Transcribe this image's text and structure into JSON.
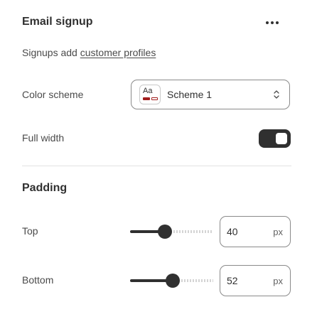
{
  "section": {
    "title": "Email signup",
    "more_icon": "more-horizontal-icon"
  },
  "signups": {
    "prefix": "Signups add ",
    "link_text": "customer profiles"
  },
  "color_scheme": {
    "label": "Color scheme",
    "swatch_text": "Aa",
    "value": "Scheme 1",
    "swatch_colors": {
      "primary": "#a11d1d",
      "background": "#ffffff"
    },
    "chevron_icon": "select-chevrons-icon"
  },
  "full_width": {
    "label": "Full width",
    "enabled": true
  },
  "padding": {
    "title": "Padding",
    "top": {
      "label": "Top",
      "value": "40",
      "unit": "px",
      "slider_fraction": 0.42
    },
    "bottom": {
      "label": "Bottom",
      "value": "52",
      "unit": "px",
      "slider_fraction": 0.51
    }
  },
  "colors": {
    "text": "#303030",
    "muted": "#4a4a4a",
    "border": "#8a8a8a",
    "divider": "#e3e3e3",
    "accent_dark": "#303030"
  }
}
